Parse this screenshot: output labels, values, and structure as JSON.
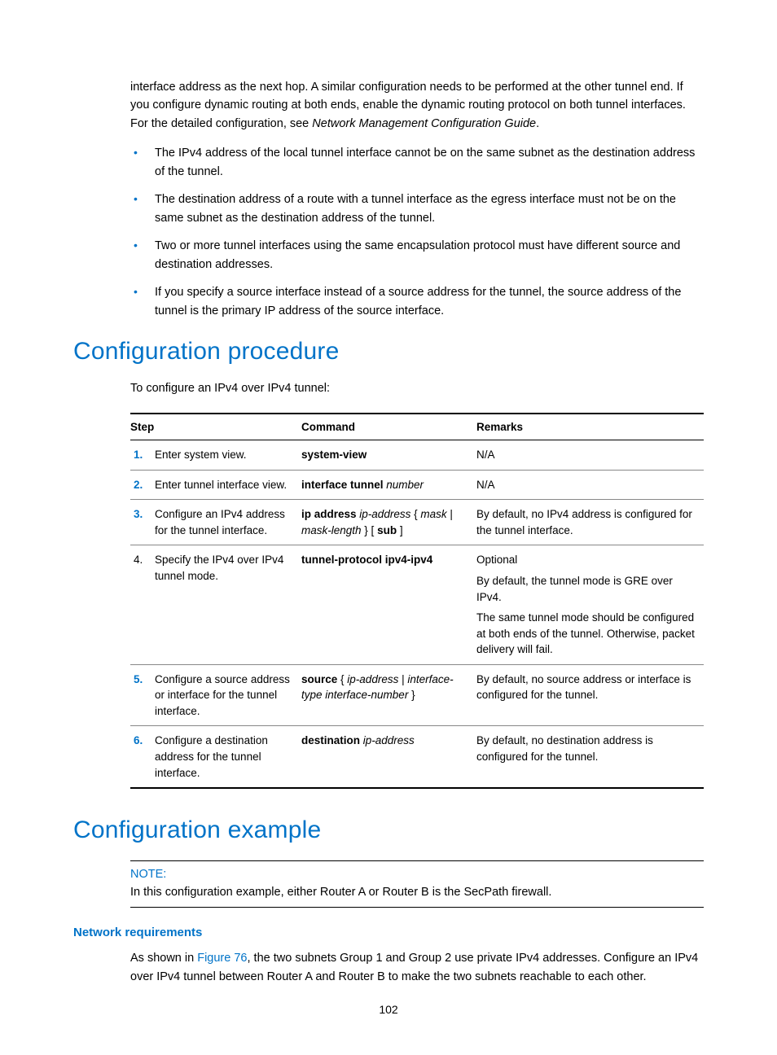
{
  "intro": {
    "paragraph": "interface address as the next hop. A similar configuration needs to be performed at the other tunnel end. If you configure dynamic routing at both ends, enable the dynamic routing protocol on both tunnel interfaces. For the detailed configuration, see ",
    "italic_tail": "Network Management Configuration Guide",
    "tail_punct": "."
  },
  "bullets": [
    "The IPv4 address of the local tunnel interface cannot be on the same subnet as the destination address of the tunnel.",
    "The destination address of a route with a tunnel interface as the egress interface must not be on the same subnet as the destination address of the tunnel.",
    "Two or more tunnel interfaces using the same encapsulation protocol must have different source and destination addresses.",
    "If you specify a source interface instead of a source address for the tunnel, the source address of the tunnel is the primary IP address of the source interface."
  ],
  "headings": {
    "procedure": "Configuration procedure",
    "example": "Configuration example",
    "network_req": "Network requirements"
  },
  "procedure_lead": "To configure an IPv4 over IPv4 tunnel:",
  "table": {
    "headers": {
      "step": "Step",
      "command": "Command",
      "remarks": "Remarks"
    },
    "rows": [
      {
        "num": "1.",
        "num_link": true,
        "step": "Enter system view.",
        "cmd_bold": "system-view",
        "cmd_italic": "",
        "remarks": [
          "N/A"
        ]
      },
      {
        "num": "2.",
        "num_link": true,
        "step": "Enter tunnel interface view.",
        "cmd_bold": "interface tunnel ",
        "cmd_italic": "number",
        "remarks": [
          "N/A"
        ]
      },
      {
        "num": "3.",
        "num_link": true,
        "step": "Configure an IPv4 address for the tunnel interface.",
        "cmd_html": "<b>ip address</b> <i>ip-address</i> { <i>mask</i> | <i>mask-length</i> } [ <b>sub</b> ]",
        "remarks": [
          "By default, no IPv4 address is configured for the tunnel interface."
        ]
      },
      {
        "num": "4.",
        "num_link": false,
        "step": "Specify the IPv4 over IPv4 tunnel mode.",
        "cmd_bold": "tunnel-protocol ipv4-ipv4",
        "cmd_italic": "",
        "remarks": [
          "Optional",
          "By default, the tunnel mode is GRE over IPv4.",
          "The same tunnel mode should be configured at both ends of the tunnel. Otherwise, packet delivery will fail."
        ]
      },
      {
        "num": "5.",
        "num_link": true,
        "step": "Configure a source address or interface for the tunnel interface.",
        "cmd_html": "<b>source</b> { <i>ip-address</i> | <i>interface-type interface-number</i> }",
        "remarks": [
          "By default, no source address or interface is configured for the tunnel."
        ]
      },
      {
        "num": "6.",
        "num_link": true,
        "step": "Configure a destination address for the tunnel interface.",
        "cmd_html": "<b>destination</b> <i>ip-address</i>",
        "remarks": [
          "By default, no destination address is configured for the tunnel."
        ]
      }
    ]
  },
  "note": {
    "label": "NOTE:",
    "text": "In this configuration example, either Router A or Router B is the SecPath firewall."
  },
  "network_req": {
    "pre": "As shown in ",
    "link": "Figure 76",
    "post": ", the two subnets Group 1 and Group 2 use private IPv4 addresses. Configure an IPv4 over IPv4 tunnel between Router A and Router B to make the two subnets reachable to each other."
  },
  "page_number": "102"
}
